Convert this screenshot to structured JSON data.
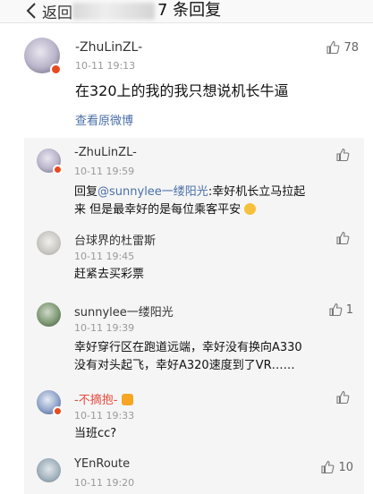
{
  "nav": {
    "back_label": "返回",
    "title": "7 条回复"
  },
  "main_comment": {
    "username": "-ZhuLinZL-",
    "time": "10-11 19:13",
    "text": "在320上的我的我只想说机长牛逼",
    "like_count": "78",
    "view_original": "查看原微博"
  },
  "replies": [
    {
      "username": "-ZhuLinZL-",
      "time": "10-11 19:59",
      "reply_prefix": "回复",
      "mention": "@sunnylee一缕阳光",
      "line1_rest": ":幸好机长立马拉起",
      "line2": "来 但是最幸好的是每位乘客平安",
      "like_count": ""
    },
    {
      "username": "台球界的杜雷斯",
      "time": "10-11 19:45",
      "text": "赶紧去买彩票",
      "like_count": ""
    },
    {
      "username": "sunnylee一缕阳光",
      "time": "10-11 19:39",
      "line1": "幸好穿行区在跑道远端，幸好没有换向A330",
      "line2": "没有对头起飞，幸好A320速度到了VR……",
      "like_count": "1"
    },
    {
      "username": "-不摘抱-",
      "time": "10-11 19:33",
      "text": "当班cc?",
      "like_count": ""
    },
    {
      "username": "YEnRoute",
      "time": "10-11 19:20",
      "like_count": "10"
    }
  ]
}
